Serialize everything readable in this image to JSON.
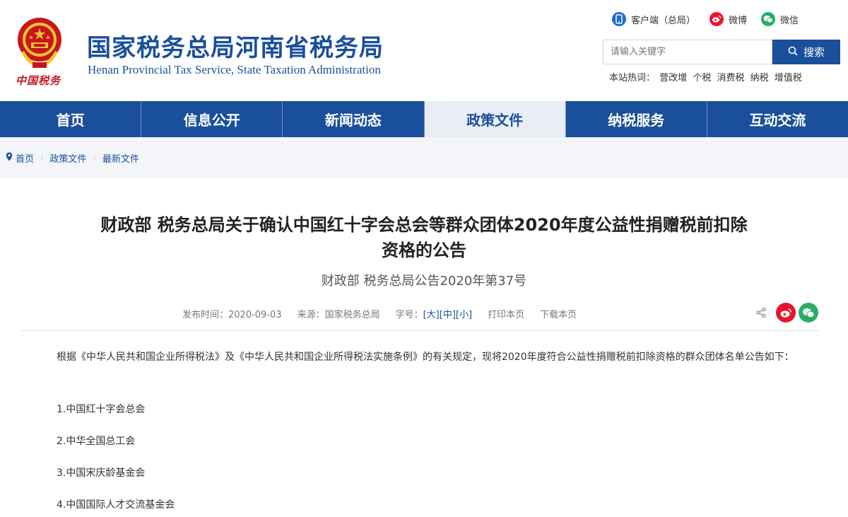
{
  "header": {
    "emblem_text": "中国税务",
    "title_cn": "国家税务总局河南省税务局",
    "title_en": "Henan Provincial Tax Service, State Taxation Administration",
    "top_links": [
      {
        "label": "客户端（总局）",
        "icon": "mobile-client-icon"
      },
      {
        "label": "微博",
        "icon": "weibo-icon"
      },
      {
        "label": "微信",
        "icon": "wechat-icon"
      }
    ],
    "search_placeholder": "请输入关键字",
    "search_button": "搜索",
    "hot_label": "本站热词：",
    "hot_words": [
      "营改增",
      "个税",
      "消费税",
      "纳税",
      "增值税"
    ]
  },
  "nav": {
    "items": [
      "首页",
      "信息公开",
      "新闻动态",
      "政策文件",
      "纳税服务",
      "互动交流"
    ],
    "active": "政策文件"
  },
  "breadcrumb": [
    "首页",
    "政策文件",
    "最新文件"
  ],
  "article": {
    "title_line1": "财政部 税务总局关于确认中国红十字会总会等群众团体2020年度公益性捐赠税前扣除",
    "title_line2": "资格的公告",
    "subtitle": "财政部 税务总局公告2020年第37号",
    "meta": {
      "publish": "发布时间：2020-09-03",
      "source": "来源：国家税务总局",
      "size_label": "字号：",
      "size_options": [
        "[大]",
        "[中]",
        "[小]"
      ],
      "print": "打印本页",
      "download": "下载本页"
    },
    "paragraph": "根据《中华人民共和国企业所得税法》及《中华人民共和国企业所得税法实施条例》的有关规定，现将2020年度符合公益性捐赠税前扣除资格的群众团体名单公告如下：",
    "list": [
      "1.中国红十字会总会",
      "2.中华全国总工会",
      "3.中国宋庆龄基金会",
      "4.中国国际人才交流基金会"
    ]
  },
  "colors": {
    "brand_blue": "#1a4f9c",
    "nav_active_bg": "#e9eef6",
    "weibo_red": "#e6162d",
    "wechat_green": "#2aae67"
  }
}
